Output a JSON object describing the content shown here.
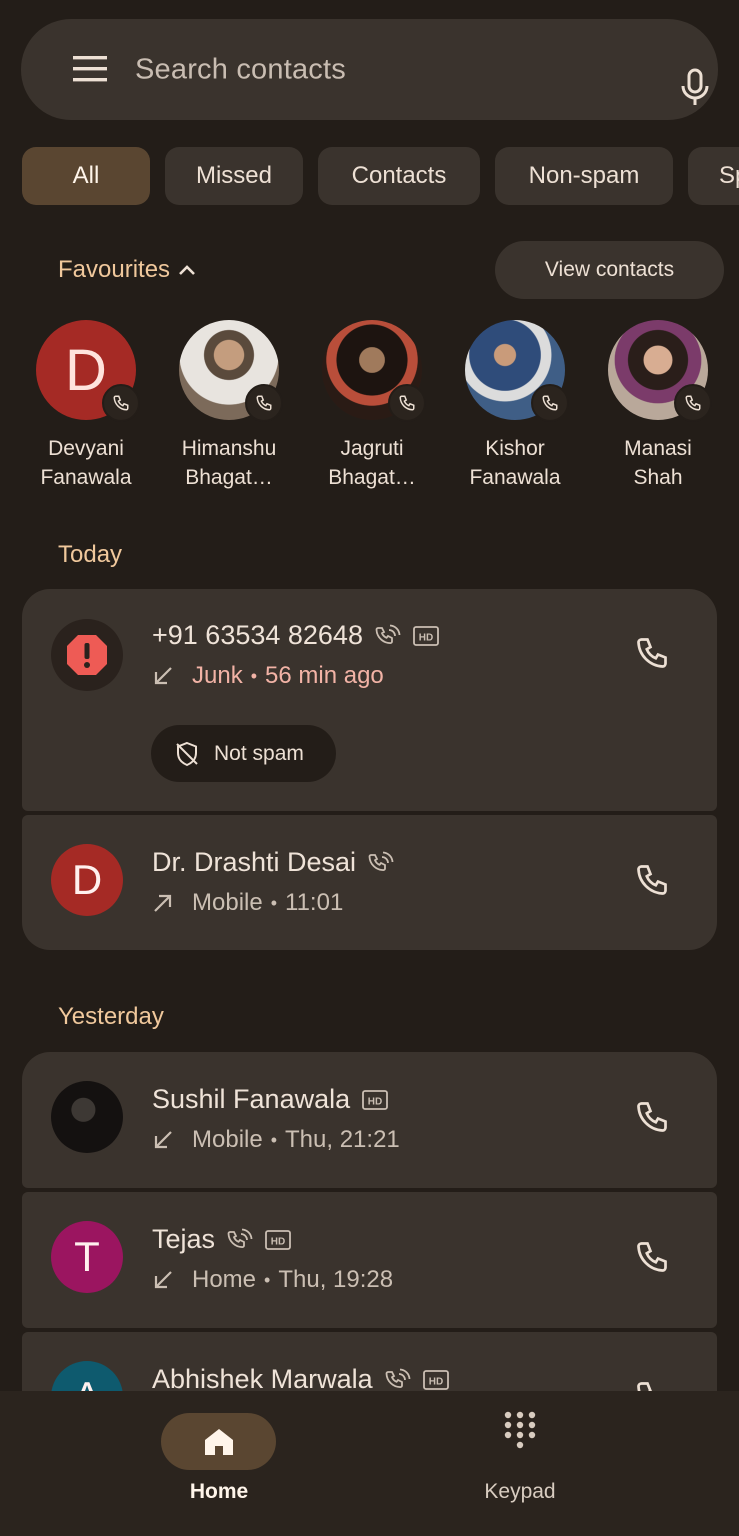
{
  "search": {
    "placeholder": "Search contacts"
  },
  "chips": [
    {
      "label": "All",
      "active": true
    },
    {
      "label": "Missed",
      "active": false
    },
    {
      "label": "Contacts",
      "active": false
    },
    {
      "label": "Non-spam",
      "active": false
    },
    {
      "label": "Sp",
      "active": false
    }
  ],
  "favourites": {
    "title": "Favourites",
    "view_contacts_label": "View contacts",
    "items": [
      {
        "name_line1": "Devyani",
        "name_line2": "Fanawala",
        "avatar_letter": "D",
        "avatar_color": "#a52a25"
      },
      {
        "name_line1": "Himanshu",
        "name_line2": "Bhagat…",
        "avatar_letter": "",
        "avatar_color": "#7c6a5a"
      },
      {
        "name_line1": "Jagruti",
        "name_line2": "Bhagat…",
        "avatar_letter": "",
        "avatar_color": "#3a2720"
      },
      {
        "name_line1": "Kishor",
        "name_line2": "Fanawala",
        "avatar_letter": "",
        "avatar_color": "#3f5e86"
      },
      {
        "name_line1": "Manasi",
        "name_line2": "Shah",
        "avatar_letter": "",
        "avatar_color": "#8e7868"
      }
    ]
  },
  "sections": {
    "today": "Today",
    "yesterday": "Yesterday"
  },
  "calls": {
    "c0": {
      "title": "+91 63534 82648",
      "type": "Junk",
      "time": "56 min ago",
      "action_label": "Not spam"
    },
    "c1": {
      "title": "Dr. Drashti Desai",
      "avatar_letter": "D",
      "avatar_color": "#a52a25",
      "type": "Mobile",
      "time": "11:01"
    },
    "c2": {
      "title": "Sushil Fanawala",
      "type": "Mobile",
      "time": "Thu, 21:21"
    },
    "c3": {
      "title": "Tejas",
      "avatar_letter": "T",
      "avatar_color": "#9b1560",
      "type": "Home",
      "time": "Thu, 19:28"
    },
    "c4": {
      "title": "Abhishek Marwala",
      "avatar_letter": "A",
      "avatar_color": "#0e5a6e"
    }
  },
  "bullet": "•",
  "hd_label": "HD",
  "nav": {
    "home_label": "Home",
    "keypad_label": "Keypad"
  },
  "colors": {
    "accent": "#f0c89c",
    "junk": "#f2b3a6",
    "spam_icon": "#ee5b55"
  }
}
